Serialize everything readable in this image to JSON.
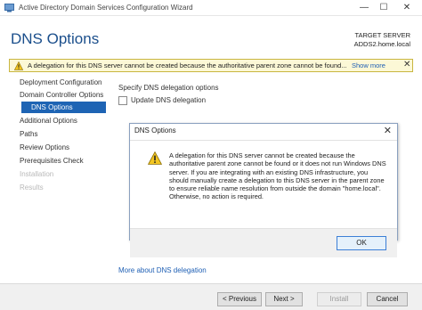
{
  "window": {
    "title": "Active Directory Domain Services Configuration Wizard",
    "minimize_glyph": "—",
    "maximize_glyph": "☐",
    "close_glyph": "✕"
  },
  "page": {
    "title": "DNS Options",
    "target_label": "TARGET SERVER",
    "target_value": "ADDS2.home.local"
  },
  "warning": {
    "text": "A delegation for this DNS server cannot be created because the authoritative parent zone cannot be found...",
    "show_more": "Show more",
    "close_glyph": "✕",
    "icon": "warning-icon",
    "color": "#fcf8d6"
  },
  "nav": {
    "items": [
      {
        "label": "Deployment Configuration",
        "state": "normal"
      },
      {
        "label": "Domain Controller Options",
        "state": "normal"
      },
      {
        "label": "DNS Options",
        "state": "active"
      },
      {
        "label": "Additional Options",
        "state": "normal"
      },
      {
        "label": "Paths",
        "state": "normal"
      },
      {
        "label": "Review Options",
        "state": "normal"
      },
      {
        "label": "Prerequisites Check",
        "state": "normal"
      },
      {
        "label": "Installation",
        "state": "disabled"
      },
      {
        "label": "Results",
        "state": "disabled"
      }
    ]
  },
  "content": {
    "section_label": "Specify DNS delegation options",
    "checkbox_label": "Update DNS delegation",
    "checkbox_checked": false,
    "more_link": "More about DNS delegation"
  },
  "dialog": {
    "title": "DNS Options",
    "close_glyph": "✕",
    "message": "A delegation for this DNS server cannot be created because the authoritative parent zone cannot be found or it does not run Windows DNS server. If you are integrating with an existing DNS infrastructure, you should manually create a delegation to this DNS server in the parent zone to ensure reliable name resolution from outside the domain \"home.local\". Otherwise, no action is required.",
    "ok_label": "OK",
    "icon": "warning-icon"
  },
  "footer": {
    "previous_label": "< Previous",
    "next_label": "Next >",
    "install_label": "Install",
    "cancel_label": "Cancel"
  },
  "colors": {
    "accent": "#1e64b4",
    "title": "#1b4f8c",
    "link": "#1e5fb4"
  }
}
